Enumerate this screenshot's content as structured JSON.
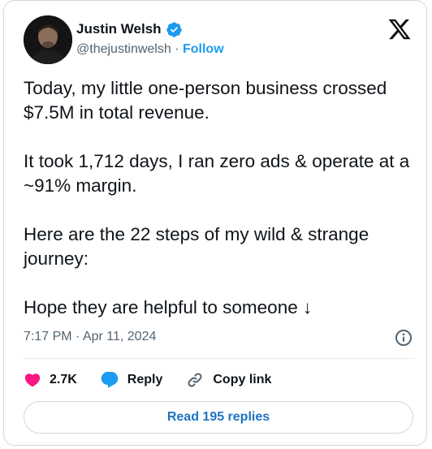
{
  "author": {
    "name": "Justin Welsh",
    "handle": "@thejustinwelsh",
    "separator": "·",
    "follow_label": "Follow",
    "verified": true
  },
  "icons": {
    "verified": "verified-badge-icon",
    "platform_logo": "x-logo-icon",
    "info": "info-icon",
    "like": "heart-icon",
    "reply": "speech-bubble-icon",
    "copy_link": "link-icon"
  },
  "tweet": {
    "paragraphs": [
      "Today, my little one-person business crossed $7.5M in total revenue.",
      "It took 1,712 days, I ran zero ads & operate at a ~91% margin.",
      "Here are the 22 steps of my wild & strange journey:",
      "Hope they are helpful to someone ↓"
    ],
    "timestamp": "7:17 PM · Apr 11, 2024"
  },
  "actions": {
    "likes_count": "2.7K",
    "reply_label": "Reply",
    "copy_link_label": "Copy link"
  },
  "footer": {
    "read_replies_label": "Read 195 replies"
  },
  "colors": {
    "text": "#0f1419",
    "secondary_text": "#536471",
    "accent_blue": "#1d9bf0",
    "like_pink": "#f91880",
    "border": "#cfd9de"
  }
}
